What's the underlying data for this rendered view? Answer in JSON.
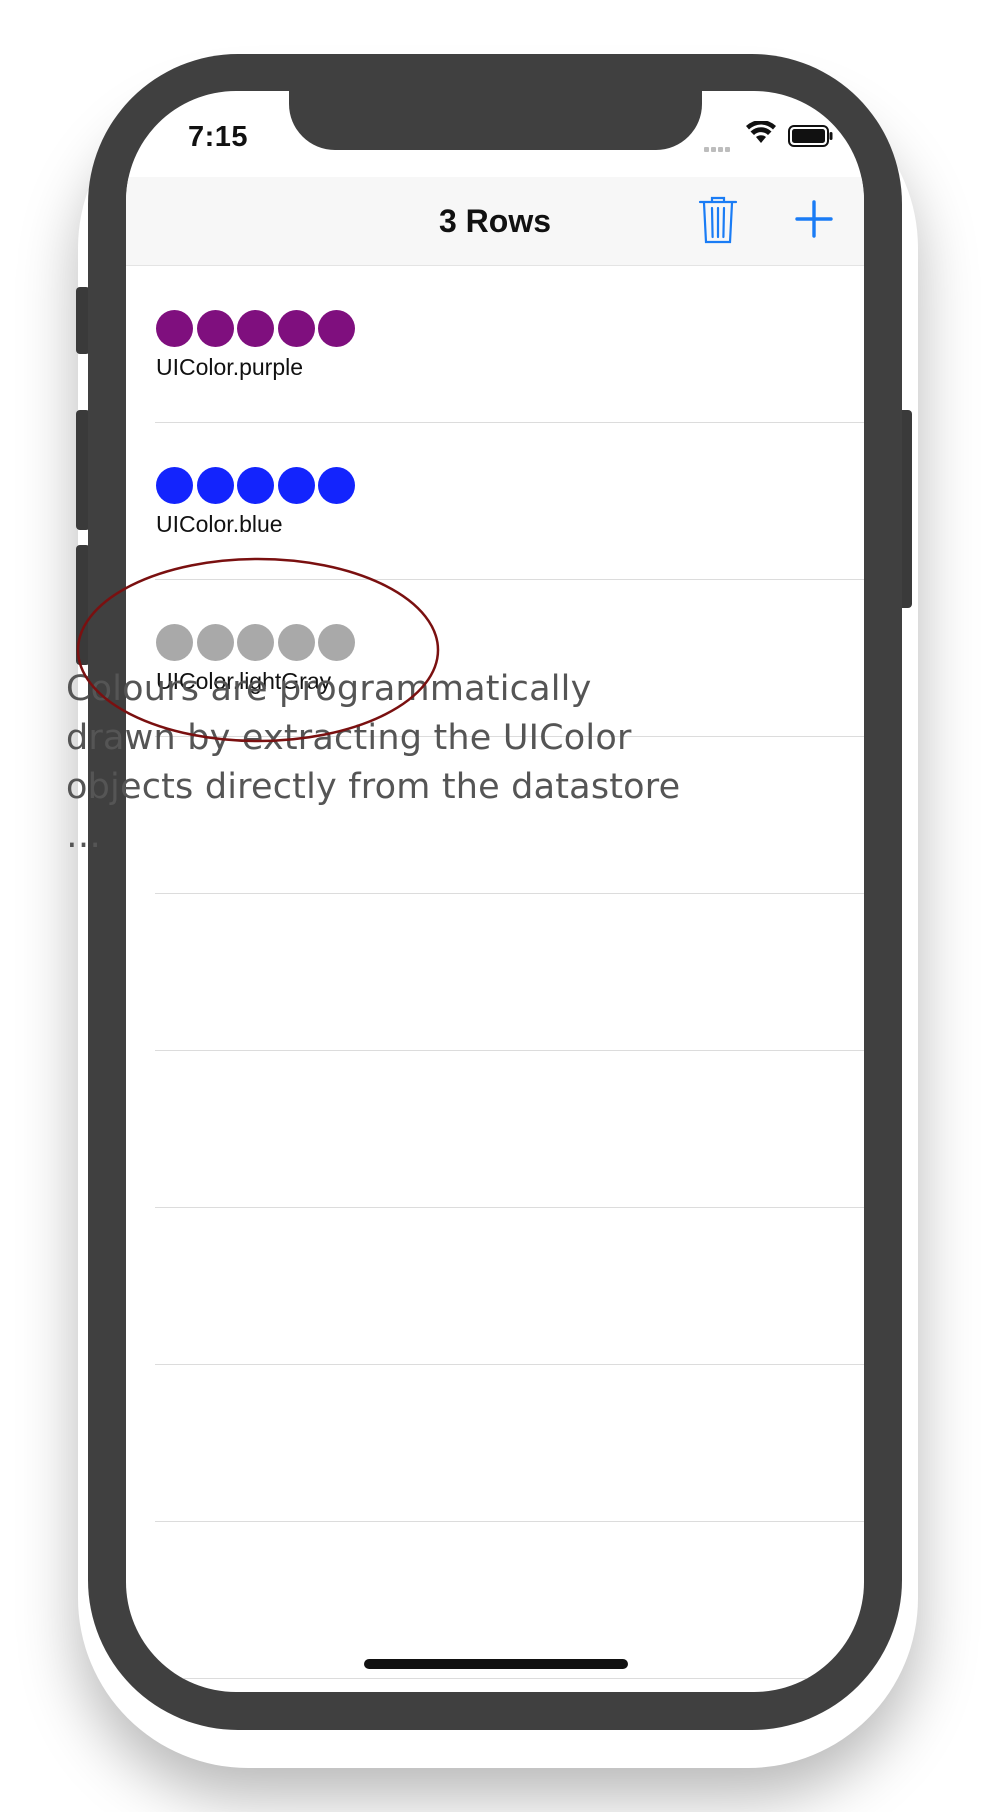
{
  "status_bar": {
    "time": "7:15"
  },
  "nav": {
    "title": "3 Rows",
    "trash_icon": "trash-icon",
    "add_icon": "plus-icon",
    "accent": "#1a7cf5"
  },
  "rows": [
    {
      "label": "UIColor.purple",
      "color": "#7f0f7e",
      "dot_count": 5
    },
    {
      "label": "UIColor.blue",
      "color": "#1324fd",
      "dot_count": 5
    },
    {
      "label": "UIColor.lightGray",
      "color": "#a9a9a9",
      "dot_count": 5
    }
  ],
  "annotation": {
    "text": "Colours are programmatically drawn by extracting the UIColor objects directly from the datastore …",
    "highlight_color": "#7a1010"
  }
}
